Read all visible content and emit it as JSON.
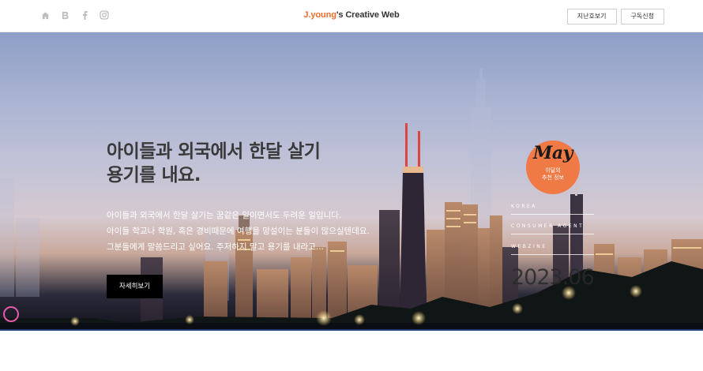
{
  "header": {
    "social_icons": [
      "home-icon",
      "blog-icon",
      "facebook-icon",
      "instagram-icon"
    ],
    "logo_accent": "J.young",
    "logo_rest": "'s Creative Web",
    "btn_archive": "지난호보기",
    "btn_subscribe": "구독신청"
  },
  "hero": {
    "headline_line1": "아이들과 외국에서 한달 살기",
    "headline_line2": "용기를 내요.",
    "desc_line1": "아이들과 외국에서 한달 살기는 꿈같은 일이면서도 두려운 일입니다.",
    "desc_line2": "아이들 학교나 학원, 혹은 경비때문에 여행을 망설이는 분들이 많으실텐데요.",
    "desc_line3": "그분들에게 말씀드리고 싶어요. 주저하지 말고 용기를 내라고...",
    "cta_label": "자세히보기",
    "badge_month": "May",
    "badge_sub_line1": "이달의",
    "badge_sub_line2": "추천 정보",
    "tag_1": "KOREA",
    "tag_2": "CONSUMER AGENT",
    "tag_3": "WEBZINE",
    "date": "2023.06"
  },
  "colors": {
    "accent": "#f07a45",
    "logo_accent": "#f26b2a",
    "cta_bg": "#000000"
  }
}
